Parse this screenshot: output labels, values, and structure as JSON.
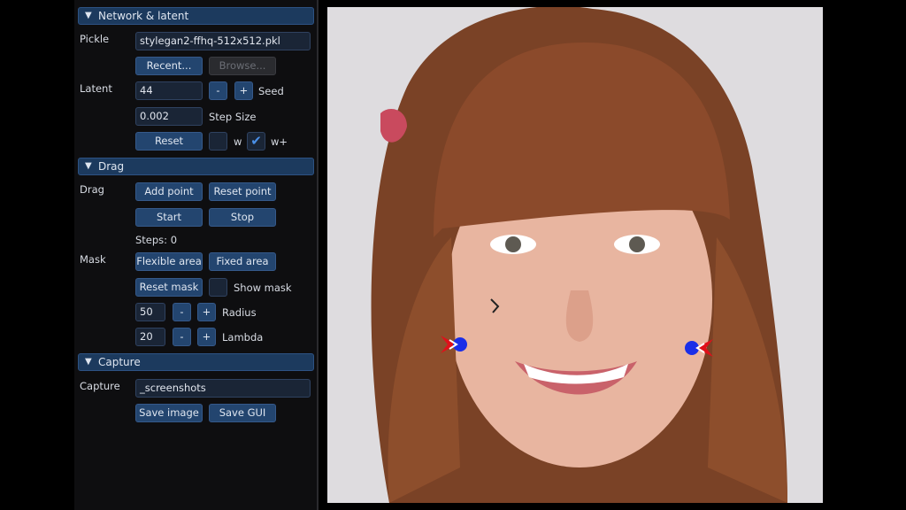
{
  "sections": {
    "network": {
      "title": "Network & latent",
      "pickle_label": "Pickle",
      "pickle_value": "stylegan2-ffhq-512x512.pkl",
      "recent": "Recent...",
      "browse": "Browse...",
      "latent_label": "Latent",
      "seed_value": "44",
      "minus": "-",
      "plus": "+",
      "seed_label": "Seed",
      "step_value": "0.002",
      "step_label": "Step Size",
      "reset": "Reset",
      "w_label": "w",
      "wplus_label": "w+",
      "w_checked": false,
      "wplus_checked": true,
      "check_glyph": "✔"
    },
    "drag": {
      "title": "Drag",
      "drag_label": "Drag",
      "add_point": "Add point",
      "reset_point": "Reset point",
      "start": "Start",
      "stop": "Stop",
      "steps": "Steps: 0",
      "mask_label": "Mask",
      "flexible": "Flexible area",
      "fixed": "Fixed area",
      "reset_mask": "Reset mask",
      "show_mask": "Show mask",
      "radius_value": "50",
      "radius_label": "Radius",
      "lambda_value": "20",
      "lambda_label": "Lambda"
    },
    "capture": {
      "title": "Capture",
      "capture_label": "Capture",
      "capture_value": "_screenshots",
      "save_image": "Save image",
      "save_gui": "Save GUI"
    }
  },
  "colors": {
    "header": "#1c3a5e",
    "button": "#23456f",
    "handle": "#e0101a",
    "target": "#1a2ee8"
  }
}
